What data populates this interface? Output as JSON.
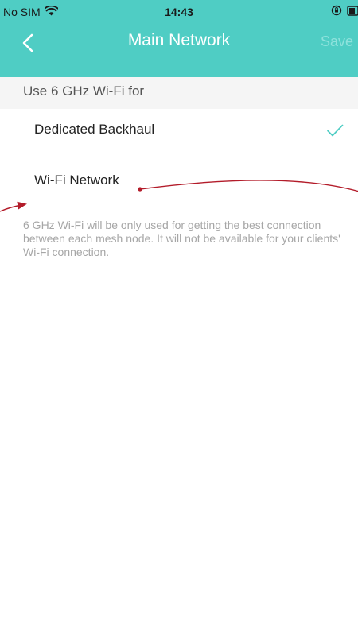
{
  "status_bar": {
    "carrier": "No SIM",
    "time": "14:43",
    "icons": [
      "wifi-icon",
      "lock-rotation-icon",
      "battery-icon"
    ]
  },
  "nav": {
    "title": "Main Network",
    "back_icon": "chevron-left-icon",
    "save_label": "Save"
  },
  "section": {
    "header": "Use 6 GHz Wi-Fi for"
  },
  "options": [
    {
      "label": "Dedicated Backhaul",
      "selected": true
    },
    {
      "label": "Wi-Fi Network",
      "selected": false
    }
  ],
  "description": "6 GHz Wi-Fi will be only used for getting the best connection between each mesh node. It will not be available for your clients' Wi-Fi connection.",
  "colors": {
    "header": "#4fcdc4",
    "accent": "#4fcdc4",
    "annotation": "#b31c2a"
  }
}
